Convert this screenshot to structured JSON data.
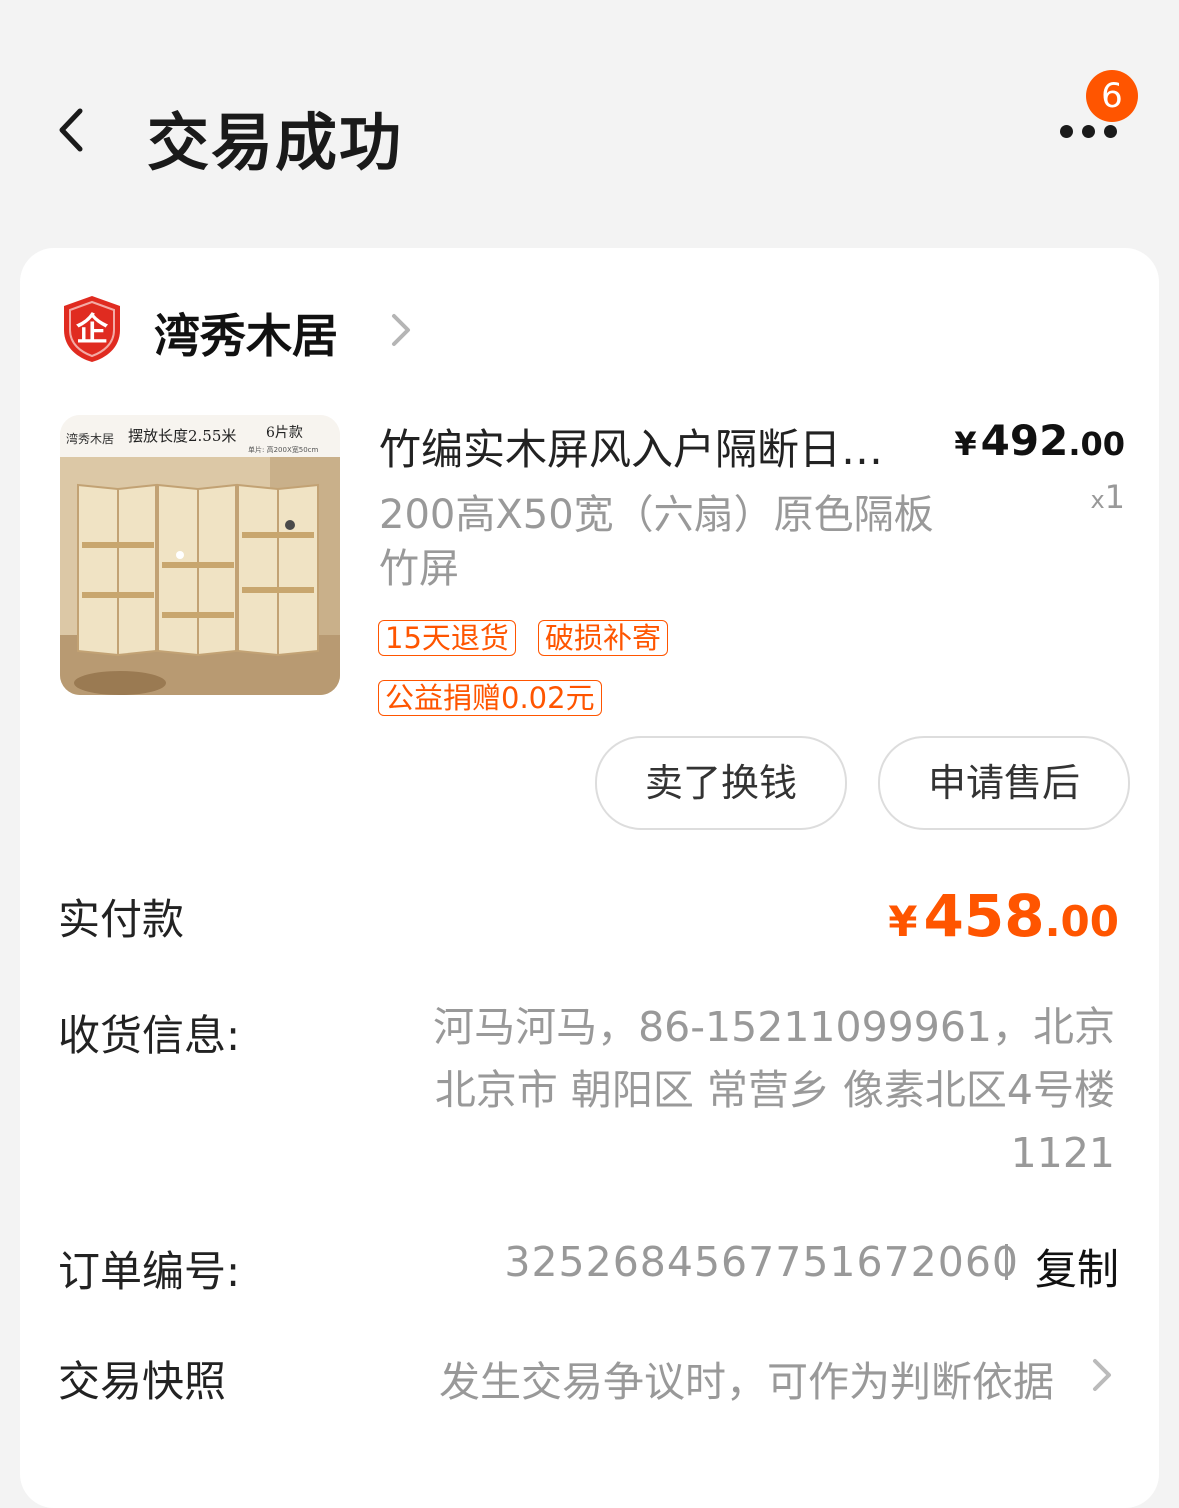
{
  "header": {
    "title": "交易成功",
    "badge_count": "6",
    "icons": {
      "back": "back-arrow-icon",
      "more": "more-dots-icon"
    }
  },
  "shop": {
    "name": "湾秀木居",
    "icon": "enterprise-shield-icon",
    "icon_text": "企",
    "chevron": "chevron-right-icon"
  },
  "product": {
    "image_caption": {
      "brand": "湾秀木居",
      "headline": "摆放长度2.55米",
      "variant": "6片款",
      "size_note": "单片: 高200X宽50cm"
    },
    "title": "竹编实木屏风入户隔断日…",
    "spec": "200高X50宽（六扇）原色隔板竹屏",
    "price_symbol": "¥",
    "price_int": "492",
    "price_dec": ".00",
    "qty_prefix": "x",
    "qty": "1",
    "tags": [
      "15天退货",
      "破损补寄",
      "公益捐赠0.02元"
    ]
  },
  "actions": {
    "sell": "卖了换钱",
    "after_sale": "申请售后"
  },
  "details": {
    "paid_label": "实付款",
    "paid_symbol": "¥",
    "paid_int": "458",
    "paid_dec": ".00",
    "shipping_label": "收货信息:",
    "shipping_value": "河马河马，86-15211099961，北京北京市 朝阳区 常营乡 像素北区4号楼1121",
    "order_label": "订单编号:",
    "order_value": "3252684567751672060",
    "copy_label": "复制",
    "snapshot_label": "交易快照",
    "snapshot_value": "发生交易争议时，可作为判断依据"
  },
  "colors": {
    "accent": "#ff5500",
    "muted": "#999999",
    "background": "#f3f3f3"
  }
}
